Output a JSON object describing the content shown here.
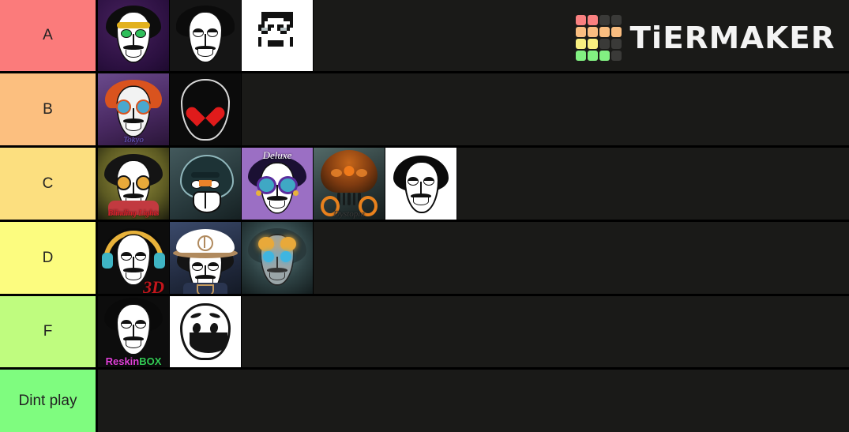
{
  "app": {
    "name": "TierMaker",
    "logo_text": "TiERMAKER",
    "background_color": "#1a1a18",
    "divider_color": "#000000"
  },
  "logo": {
    "grid_colors": [
      [
        "#f98080",
        "#f98080",
        "#3a3a38",
        "#3a3a38"
      ],
      [
        "#f9bd80",
        "#f9bd80",
        "#f9bd80",
        "#f9bd80"
      ],
      [
        "#f9f080",
        "#f9f080",
        "#3a3a38",
        "#3a3a38"
      ],
      [
        "#82f082",
        "#82f082",
        "#82f082",
        "#3a3a38"
      ]
    ]
  },
  "tiers": [
    {
      "label": "A",
      "color": "#fb7b7b",
      "items": [
        {
          "name": "incredibox-alpha",
          "caption": "",
          "bg": "#2b1040",
          "art": "alpha"
        },
        {
          "name": "incredibox-little-miss",
          "caption": "",
          "bg": "#151515",
          "art": "classic"
        },
        {
          "name": "incredibox-pixel",
          "caption": "",
          "bg": "#ffffff",
          "art": "pixel"
        }
      ]
    },
    {
      "label": "B",
      "color": "#fcbf7f",
      "items": [
        {
          "name": "incredibox-tokyo",
          "caption": "Tokyo",
          "caption_color": "#6f5fd0",
          "bg": "#4a2a63",
          "art": "tokyo"
        },
        {
          "name": "incredibox-heart",
          "caption": "",
          "bg": "#0b0b0b",
          "art": "heart"
        }
      ]
    },
    {
      "label": "C",
      "color": "#fcdf7f",
      "items": [
        {
          "name": "incredibox-blinding-lights",
          "caption": "Blinding Lights",
          "caption_color": "#d4232a",
          "bg": "#6d6a2a",
          "art": "blinding"
        },
        {
          "name": "incredibox-evadare",
          "caption": "",
          "bg": "#2d4246",
          "art": "evadare"
        },
        {
          "name": "incredibox-deluxe",
          "caption": "Deluxe",
          "caption_color": "#ffffff",
          "caption_top": true,
          "bg": "#9b6fc4",
          "art": "deluxe"
        },
        {
          "name": "incredibox-dystopia",
          "caption": "Dystopia",
          "caption_color": "#3c3c3c",
          "bg": "#3e4a4a",
          "art": "dystopia"
        },
        {
          "name": "incredibox-sketch",
          "caption": "",
          "bg": "#ffffff",
          "art": "sketch"
        }
      ]
    },
    {
      "label": "D",
      "color": "#fcfc7f",
      "items": [
        {
          "name": "incredibox-3d",
          "caption": "3D",
          "caption_color": "#c4161c",
          "bg": "#0d0d0d",
          "art": "threed"
        },
        {
          "name": "incredibox-sunrise",
          "caption": "",
          "bg": "#2a3550",
          "art": "cap"
        },
        {
          "name": "incredibox-armed",
          "caption": "",
          "bg": "#32474a",
          "art": "armed"
        }
      ]
    },
    {
      "label": "F",
      "color": "#bffc7f",
      "items": [
        {
          "name": "incredibox-reskinbox",
          "caption": "ReskinBOX",
          "caption_color": "#e040d8",
          "caption_color2": "#33cc55",
          "bg": "#0d0d0d",
          "art": "reskin"
        },
        {
          "name": "incredibox-clown",
          "caption": "",
          "bg": "#ffffff",
          "art": "clown"
        }
      ]
    },
    {
      "label": "Dint play",
      "color": "#7ffc7f",
      "items": []
    }
  ]
}
